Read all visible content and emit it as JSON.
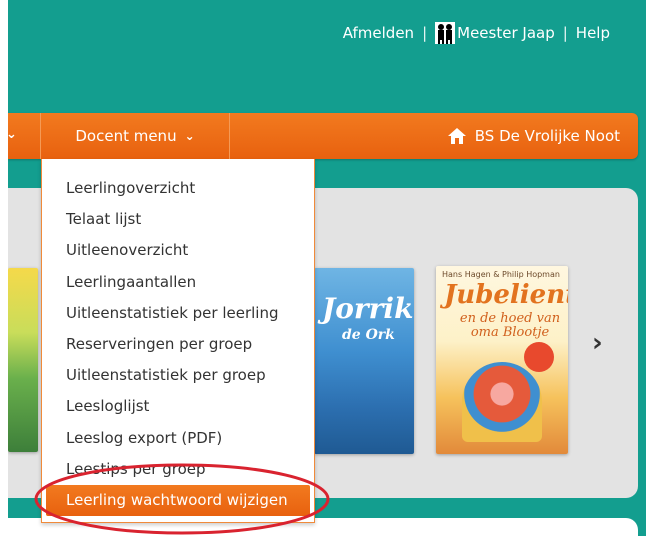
{
  "header": {
    "logout_label": "Afmelden",
    "separator": "|",
    "user_name": "Meester Jaap",
    "help_label": "Help"
  },
  "nav": {
    "docent_menu_label": "Docent menu",
    "school_name": "BS De Vrolijke Noot"
  },
  "dropdown": {
    "items": [
      {
        "label": "Leerlingoverzicht"
      },
      {
        "label": "Telaat lijst"
      },
      {
        "label": "Uitleenoverzicht"
      },
      {
        "label": "Leerlingaantallen"
      },
      {
        "label": "Uitleenstatistiek per leerling"
      },
      {
        "label": "Reserveringen per groep"
      },
      {
        "label": "Uitleenstatistiek per groep"
      },
      {
        "label": "Leesloglijst"
      },
      {
        "label": "Leeslog export (PDF)"
      },
      {
        "label": "Leestips per groep"
      },
      {
        "label": "Leerling wachtwoord wijzigen"
      }
    ],
    "active_index": 10
  },
  "books": {
    "jorrik_title": "Jorrik",
    "jorrik_sub": "de Ork",
    "jubel_authors": "Hans Hagen & Philip Hopman",
    "jubel_title": "Jubelientje",
    "jubel_subtitle": "en de hoed van oma Blootje"
  },
  "colors": {
    "teal_background": "#139e8f",
    "orange_nav": "#f27a1f",
    "panel_gray": "#e3e3e3",
    "annotation_red": "#d9232f"
  }
}
